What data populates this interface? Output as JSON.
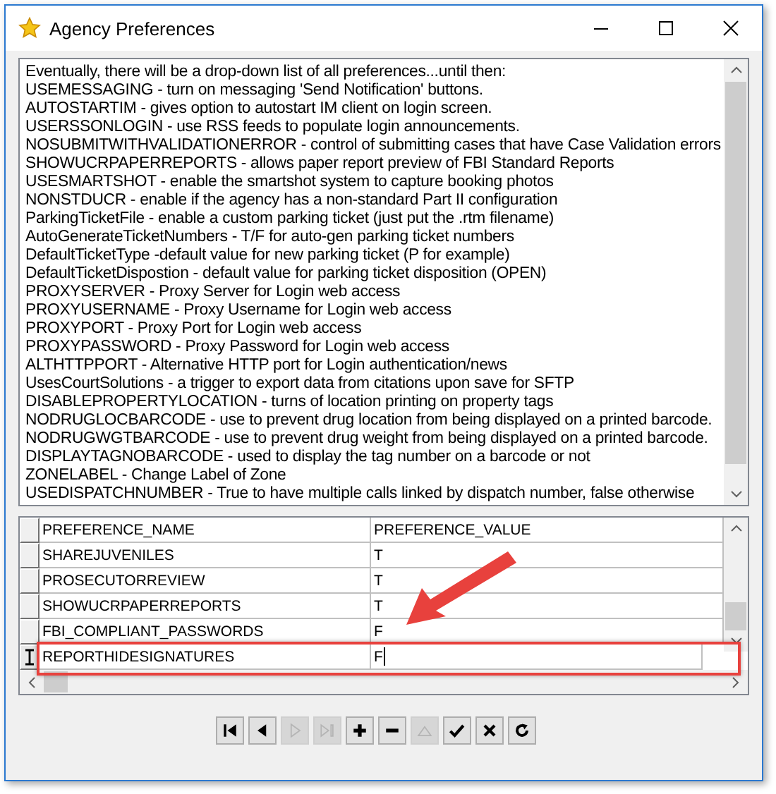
{
  "window": {
    "title": "Agency Preferences"
  },
  "notes": [
    "Eventually, there will be a drop-down list of all preferences...until then:",
    "USEMESSAGING - turn on messaging 'Send Notification' buttons.",
    "AUTOSTARTIM - gives option to autostart IM client on login screen.",
    "USERSSONLOGIN - use RSS feeds to populate login announcements.",
    "NOSUBMITWITHVALIDATIONERROR - control of submitting cases that have Case Validation errors",
    "SHOWUCRPAPERREPORTS - allows paper report preview of FBI Standard Reports",
    "USESMARTSHOT - enable the smartshot system to capture booking photos",
    "NONSTDUCR - enable if the agency has a non-standard Part II configuration",
    "ParkingTicketFile - enable a custom parking ticket (just put the .rtm filename)",
    "AutoGenerateTicketNumbers - T/F for auto-gen parking ticket numbers",
    "DefaultTicketType -default value for new parking ticket (P for example)",
    "DefaultTicketDispostion - default value for parking ticket disposition (OPEN)",
    "PROXYSERVER - Proxy Server for Login web access",
    "PROXYUSERNAME - Proxy Username for Login web access",
    "PROXYPORT - Proxy Port for Login web access",
    "PROXYPASSWORD - Proxy Password for Login web access",
    "ALTHTTPPORT - Alternative HTTP port for Login authentication/news",
    "UsesCourtSolutions - a trigger to export data from citations upon save for SFTP",
    "DISABLEPROPERTYLOCATION - turns of location printing on property tags",
    "NODRUGLOCBARCODE - use to prevent drug location from being displayed on a printed barcode.",
    "NODRUGWGTBARCODE - use to prevent drug weight from being displayed on a printed barcode.",
    "DISPLAYTAGNOBARCODE - used to display the tag number on a barcode or not",
    "ZONELABEL - Change Label of Zone",
    "USEDISPATCHNUMBER - True to have multiple calls linked by dispatch number, false otherwise"
  ],
  "table": {
    "columns": [
      "PREFERENCE_NAME",
      "PREFERENCE_VALUE"
    ],
    "rows": [
      {
        "cells": [
          "SHAREJUVENILES",
          "T"
        ],
        "selected": false
      },
      {
        "cells": [
          "PROSECUTORREVIEW",
          "T"
        ],
        "selected": false
      },
      {
        "cells": [
          "SHOWUCRPAPERREPORTS",
          "T"
        ],
        "selected": false
      },
      {
        "cells": [
          "FBI_COMPLIANT_PASSWORDS",
          "F"
        ],
        "selected": false
      },
      {
        "cells": [
          "REPORTHIDESIGNATURES",
          "F"
        ],
        "selected": true
      }
    ]
  },
  "navigator": [
    {
      "kind": "first",
      "disabled": false
    },
    {
      "kind": "prior",
      "disabled": false
    },
    {
      "kind": "next",
      "disabled": true
    },
    {
      "kind": "last",
      "disabled": true
    },
    {
      "kind": "insert",
      "disabled": false
    },
    {
      "kind": "delete",
      "disabled": false
    },
    {
      "kind": "edit",
      "disabled": true
    },
    {
      "kind": "post",
      "disabled": false
    },
    {
      "kind": "cancel",
      "disabled": false
    },
    {
      "kind": "refresh",
      "disabled": false
    }
  ]
}
